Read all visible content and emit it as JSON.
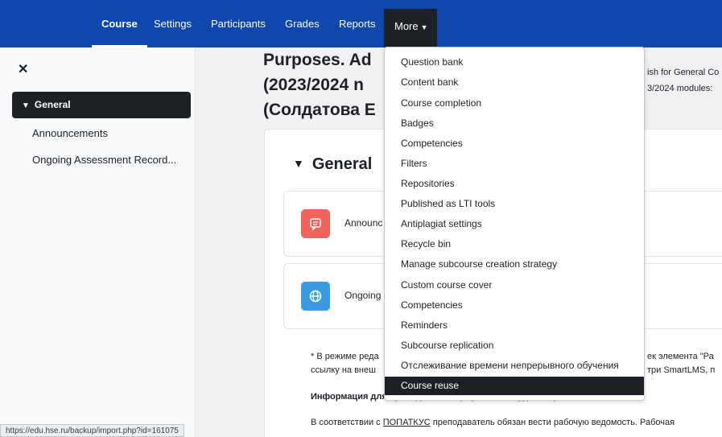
{
  "nav": {
    "tabs": [
      "Course",
      "Settings",
      "Participants",
      "Grades",
      "Reports"
    ],
    "more_label": "More"
  },
  "sidebar": {
    "section": "General",
    "items": [
      "Announcements",
      "Ongoing Assessment Record..."
    ]
  },
  "main": {
    "title_lines": [
      "Purposes. Ad",
      "(2023/2024 n",
      "(Солдатова Е"
    ],
    "right_lines": [
      "ish for General Co",
      "3/2024 modules:"
    ],
    "section_title": "General",
    "activities": [
      {
        "name": "Announc",
        "icon": "forum-icon",
        "color": "#f0645a"
      },
      {
        "name": "Ongoing",
        "icon": "url-globe-icon",
        "color": "#399be2"
      }
    ],
    "notes": {
      "line1_left": "* В режиме реда",
      "line1_right": "ек элемента \"Ра",
      "line2_left": "ссылку на внеш",
      "line2_right": "три SmartLMS, п",
      "line3": "Информация для преподавателя (скрыто от студентов):",
      "line4_prefix": "В соответствии с ",
      "line4_link": "ПОПАТКУС",
      "line4_suffix": " преподаватель обязан вести рабочую ведомость. Рабочая"
    }
  },
  "dropdown": {
    "items": [
      "Question bank",
      "Content bank",
      "Course completion",
      "Badges",
      "Competencies",
      "Filters",
      "Repositories",
      "Published as LTI tools",
      "Antiplagiat settings",
      "Recycle bin",
      "Manage subcourse creation strategy",
      "Custom course cover",
      "Competencies",
      "Reminders",
      "Subcourse replication",
      "Отслеживание времени непрерывного обучения"
    ],
    "selected": "Course reuse"
  },
  "status_url": "https://edu.hse.ru/backup/import.php?id=161075",
  "colors": {
    "nav_bg": "#0f47ad",
    "dark": "#1d2125"
  }
}
